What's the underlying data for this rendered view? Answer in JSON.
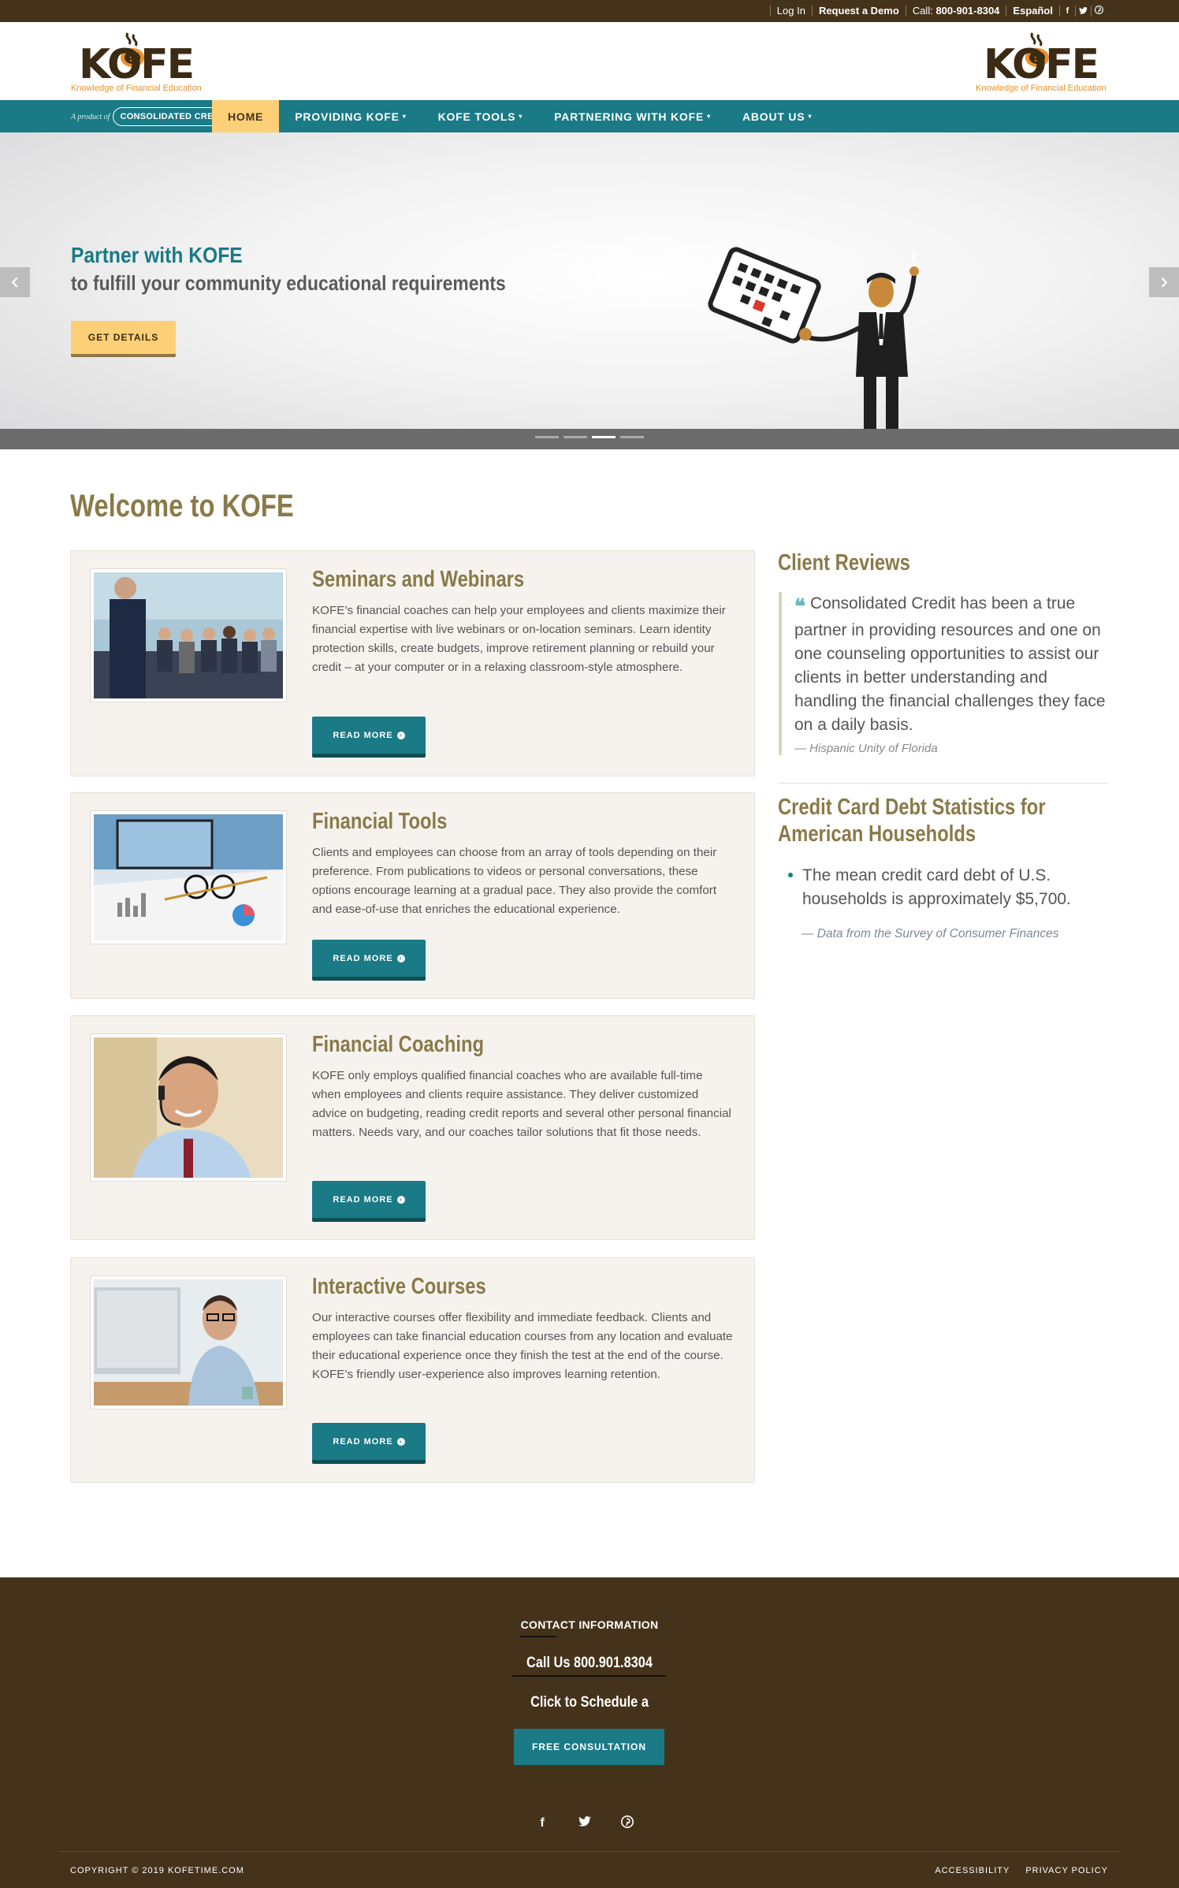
{
  "topbar": {
    "login": "Log In",
    "request_demo": "Request a Demo",
    "call_label": "Call:",
    "call_number": "800-901-8304",
    "language": "Español",
    "social": [
      "f",
      "t",
      "p"
    ]
  },
  "header": {
    "logo_text": "KOFE",
    "logo_tagline": "Knowledge of Financial Education"
  },
  "nav": {
    "product_of": "A product of",
    "partner_brand": "CONSOLIDATED CREDIT",
    "items": [
      {
        "label": "HOME",
        "active": true
      },
      {
        "label": "PROVIDING KOFE",
        "caret": "▾"
      },
      {
        "label": "KOFE TOOLS",
        "caret": "▾"
      },
      {
        "label": "PARTNERING WITH KOFE",
        "caret": "▾"
      },
      {
        "label": "ABOUT US",
        "caret": "▾"
      }
    ]
  },
  "hero": {
    "title": "Partner with KOFE",
    "subtitle": "to fulfill your community educational requirements",
    "cta": "GET DETAILS",
    "prev": "‹",
    "next": "›",
    "slide_count": 4,
    "active_slide": 3
  },
  "main": {
    "heading": "Welcome to KOFE",
    "cards": [
      {
        "title": "Seminars and Webinars",
        "body": "KOFE’s financial coaches can help your employees and clients maximize their financial expertise with live webinars or on-location seminars. Learn identity protection skills, create budgets, improve retirement planning or rebuild your credit – at your computer or in a relaxing classroom-style atmosphere.",
        "button": "READ MORE"
      },
      {
        "title": "Financial Tools",
        "body": "Clients and employees can choose from an array of tools depending on their preference. From publications to videos or personal conversations, these options encourage learning at a gradual pace. They also provide the comfort and ease-of-use that enriches the educational experience.",
        "button": "READ MORE"
      },
      {
        "title": "Financial Coaching",
        "body": "KOFE only employs qualified financial coaches who are available full-time when employees and clients require assistance. They deliver customized advice on budgeting, reading credit reports and several other personal financial matters. Needs vary, and our coaches tailor solutions that fit those needs.",
        "button": "READ MORE"
      },
      {
        "title": "Interactive Courses",
        "body": "Our interactive courses offer flexibility and immediate feedback. Clients and employees can take financial education courses from any location and evaluate their educational experience once they finish the test at the end of the course. KOFE’s friendly user-experience also improves learning retention.",
        "button": "READ MORE"
      }
    ]
  },
  "sidebar": {
    "reviews_title": "Client Reviews",
    "review_text": "Consolidated Credit has been a true partner in providing resources and one on one counseling opportunities to assist our clients in better understanding and handling the financial challenges they face on a daily basis.",
    "review_cite": "— Hispanic Unity of Florida",
    "stats_title_1": "Credit Card Debt Statistics for",
    "stats_title_2": "American Households",
    "stat_text": "The mean credit card debt of U.S. households is approximately $5,700.",
    "stat_cite": "— Data from the Survey of Consumer Finances"
  },
  "footer": {
    "contact_heading": "CONTACT INFORMATION",
    "call_us": "Call Us 800.901.8304",
    "schedule": "Click to Schedule a",
    "consultation_button": "FREE CONSULTATION",
    "social": [
      "f",
      "t",
      "p"
    ],
    "copyright": "COPYRIGHT © 2019 KOFETIME.COM",
    "accessibility": "ACCESSIBILITY",
    "privacy": "PRIVACY POLICY"
  },
  "colors": {
    "brown": "#45321a",
    "teal": "#1a7a86",
    "gold": "#fdd077",
    "olive": "#8a7a48",
    "orange": "#e8912a"
  },
  "icons": [
    "facebook-icon",
    "twitter-icon",
    "pinterest-icon",
    "quote-icon",
    "chevron-left-icon",
    "chevron-right-icon",
    "arrow-circle-right-icon"
  ]
}
